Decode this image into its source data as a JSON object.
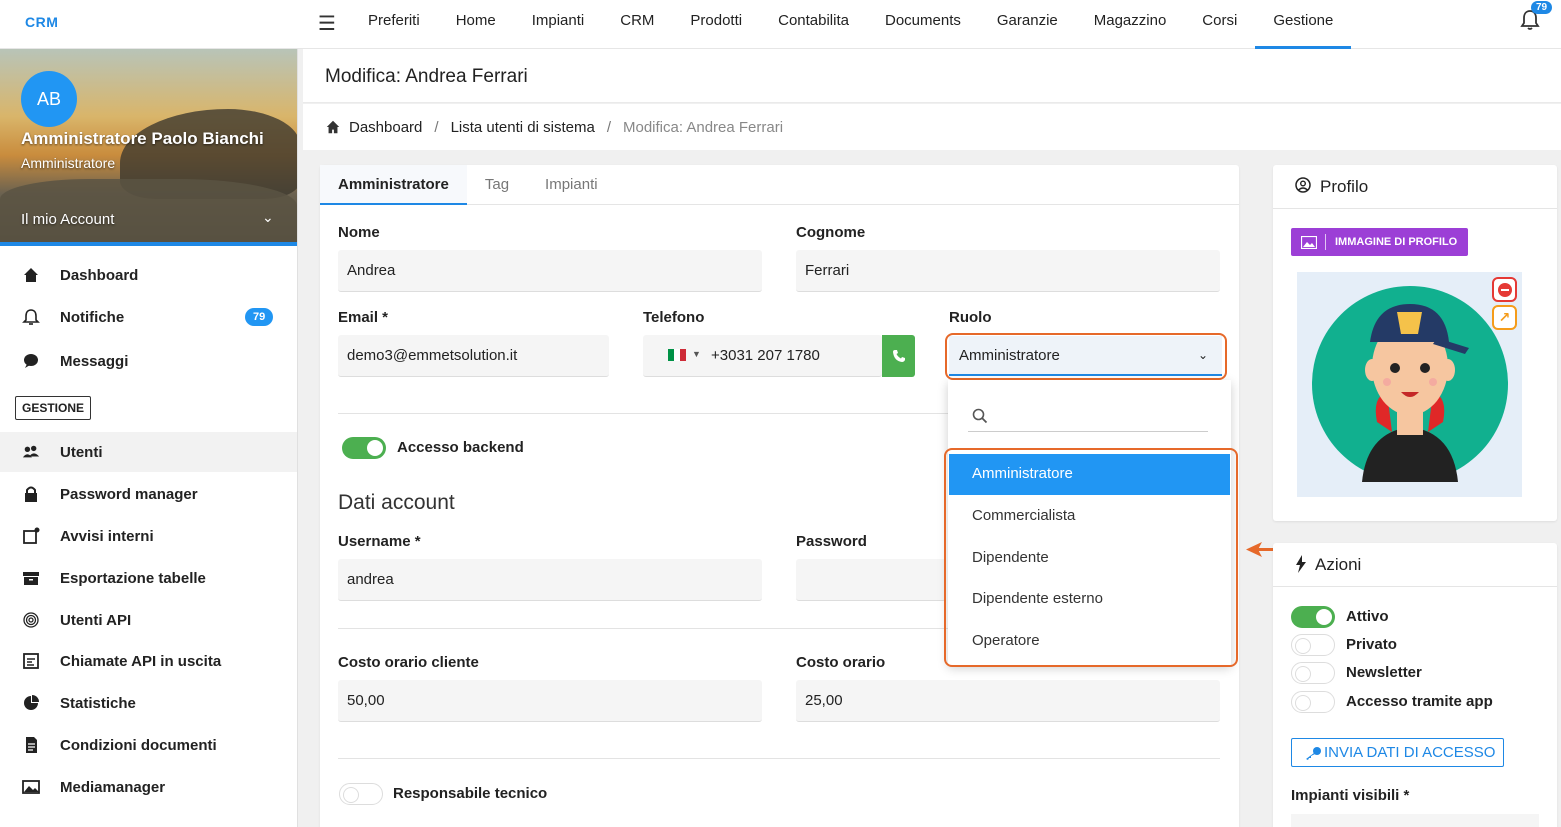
{
  "logo": "CRM",
  "topnav": [
    "Preferiti",
    "Home",
    "Impianti",
    "CRM",
    "Prodotti",
    "Contabilita",
    "Documents",
    "Garanzie",
    "Magazzino",
    "Corsi",
    "Gestione"
  ],
  "notifications_count": "79",
  "user": {
    "initials": "AB",
    "name": "Amministratore Paolo Bianchi",
    "role": "Amministratore",
    "account": "Il mio Account"
  },
  "sidebar": {
    "items_top": [
      {
        "label": "Dashboard",
        "icon": "home-icon"
      },
      {
        "label": "Notifiche",
        "icon": "bell-icon",
        "badge": "79"
      },
      {
        "label": "Messaggi",
        "icon": "chat-icon"
      }
    ],
    "section": "GESTIONE",
    "items": [
      {
        "label": "Utenti",
        "icon": "users-icon"
      },
      {
        "label": "Password manager",
        "icon": "lock-icon"
      },
      {
        "label": "Avvisi interni",
        "icon": "notice-icon"
      },
      {
        "label": "Esportazione tabelle",
        "icon": "archive-icon"
      },
      {
        "label": "Utenti API",
        "icon": "fingerprint-icon"
      },
      {
        "label": "Chiamate API in uscita",
        "icon": "api-icon"
      },
      {
        "label": "Statistiche",
        "icon": "pie-chart-icon"
      },
      {
        "label": "Condizioni documenti",
        "icon": "document-icon"
      },
      {
        "label": "Mediamanager",
        "icon": "image-icon"
      }
    ]
  },
  "page": {
    "title": "Modifica: Andrea Ferrari",
    "breadcrumb": [
      "Dashboard",
      "Lista utenti di sistema",
      "Modifica: Andrea Ferrari"
    ]
  },
  "tabs": [
    "Amministratore",
    "Tag",
    "Impianti"
  ],
  "form": {
    "nome_label": "Nome",
    "nome_value": "Andrea",
    "cognome_label": "Cognome",
    "cognome_value": "Ferrari",
    "email_label": "Email *",
    "email_value": "demo3@emmetsolution.it",
    "telefono_label": "Telefono",
    "telefono_value": "+3031 207 1780",
    "ruolo_label": "Ruolo",
    "ruolo_value": "Amministratore",
    "accesso_backend": "Accesso backend",
    "dati_account": "Dati account",
    "username_label": "Username *",
    "username_value": "andrea",
    "password_label": "Password",
    "costo_cliente_label": "Costo orario cliente",
    "costo_cliente_value": "50,00",
    "costo_label": "Costo orario",
    "costo_value": "25,00",
    "responsabile": "Responsabile tecnico"
  },
  "dropdown_options": [
    "Amministratore",
    "Commercialista",
    "Dipendente",
    "Dipendente esterno",
    "Operatore"
  ],
  "profilo": {
    "title": "Profilo",
    "button": "IMMAGINE DI PROFILO"
  },
  "azioni": {
    "title": "Azioni",
    "toggles": [
      {
        "label": "Attivo",
        "on": true
      },
      {
        "label": "Privato",
        "on": false
      },
      {
        "label": "Newsletter",
        "on": false
      },
      {
        "label": "Accesso tramite app",
        "on": false
      }
    ],
    "send_button": "INVIA DATI DI ACCESSO",
    "impianti_label": "Impianti visibili *"
  },
  "colors": {
    "accent": "#1e88e5",
    "success": "#4caf50",
    "highlight": "#e6692a",
    "purple": "#9c3fd6"
  }
}
